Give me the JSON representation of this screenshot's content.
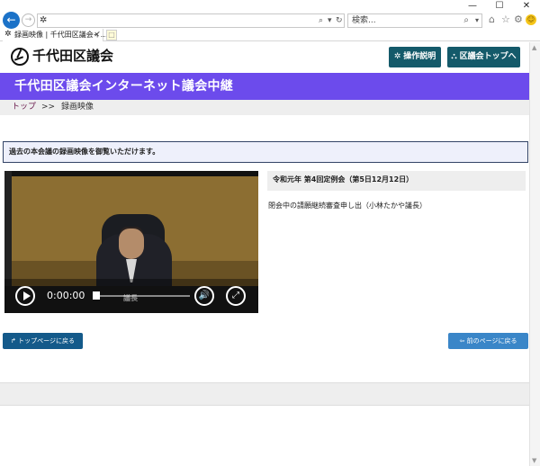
{
  "browser": {
    "window_controls": {
      "minimize": "—",
      "maximize": "☐",
      "close": "✕"
    },
    "nav": {
      "back_icon": "←",
      "forward_icon": "→"
    },
    "address": {
      "favicon": "✲",
      "search_icon": "⌕",
      "dropdown": "▾",
      "refresh": "↻"
    },
    "search": {
      "placeholder": "検索...",
      "icon": "⌕",
      "dropdown": "▾"
    },
    "toolbar_icons": {
      "home": "⌂",
      "favorites": "☆",
      "settings": "⚙",
      "smiley": "☺"
    },
    "tab": {
      "favicon": "✲",
      "title": "録画映像 | 千代田区議会イ...",
      "close": "✕"
    },
    "new_tab_icon": "□"
  },
  "header": {
    "logo_text": "千代田区議会",
    "help_button": {
      "icon": "✲",
      "label": "操作説明"
    },
    "council_top_button": {
      "icon": "⛬",
      "label": "区議会トップへ"
    }
  },
  "banner": {
    "title": "千代田区議会インターネット議会中継"
  },
  "breadcrumb": {
    "top": "トップ",
    "separator": ">>",
    "current": "録画映像"
  },
  "notice": {
    "text": "過去の本会議の録画映像を御覧いただけます。"
  },
  "video": {
    "time": "0:00:00",
    "progress": 0.0,
    "nameplate": "議長",
    "volume_icon": "🔊",
    "fullscreen_icon": "⤢"
  },
  "session": {
    "title": "令和元年 第4回定例会（第5日12月12日）",
    "item": "閉会中の請願継続審査申し出（小林たかや議長）"
  },
  "buttons": {
    "top_page": {
      "icon": "↱",
      "label": "トップページに戻る"
    },
    "prev_page": {
      "icon": "⇦",
      "label": "前のページに戻る"
    }
  },
  "colors": {
    "banner": "#6c4bec",
    "header_button": "#145a6a",
    "top_button": "#145a8a",
    "prev_button": "#3a86c8",
    "breadcrumb_link": "#6a1b4d"
  }
}
